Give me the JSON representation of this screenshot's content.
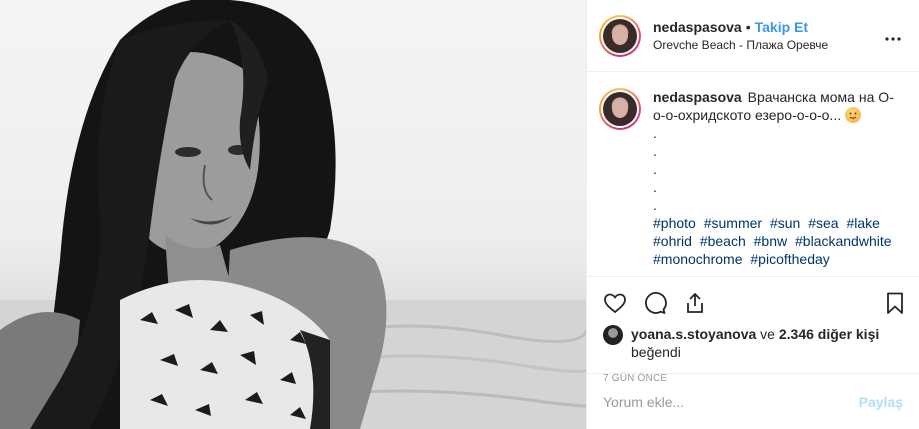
{
  "post": {
    "photo_alt": "Black and white portrait photo"
  },
  "header": {
    "username": "nedaspasova",
    "separator": "•",
    "follow_label": "Takip Et",
    "location": "Orevche Beach - Плажа Оревче",
    "more_icon": "more-options-icon"
  },
  "caption": {
    "username": "nedaspasova",
    "text": "Врачанска мома на О-о-о-охридското езеро-о-о-о...",
    "emoji": "smiling-face-icon",
    "dots": [
      ".",
      ".",
      ".",
      ".",
      "."
    ],
    "hashtags": [
      "#photo",
      "#summer",
      "#sun",
      "#sea",
      "#lake",
      "#ohrid",
      "#beach",
      "#bnw",
      "#blackandwhite",
      "#monochrome",
      "#picoftheday"
    ]
  },
  "actions": {
    "like_icon": "heart-icon",
    "comment_icon": "comment-icon",
    "share_icon": "share-icon",
    "save_icon": "bookmark-icon"
  },
  "likes": {
    "liker": "yoana.s.stoyanova",
    "connector": "ve",
    "others": "2.346 diğer kişi",
    "suffix": "beğendi"
  },
  "timestamp": "7 GÜN ÖNCE",
  "comment": {
    "placeholder": "Yorum ekle...",
    "post_label": "Paylaş"
  },
  "colors": {
    "link": "#3897f0",
    "hashtag": "#003569",
    "muted": "#999999",
    "post_disabled": "#b2dffc"
  }
}
